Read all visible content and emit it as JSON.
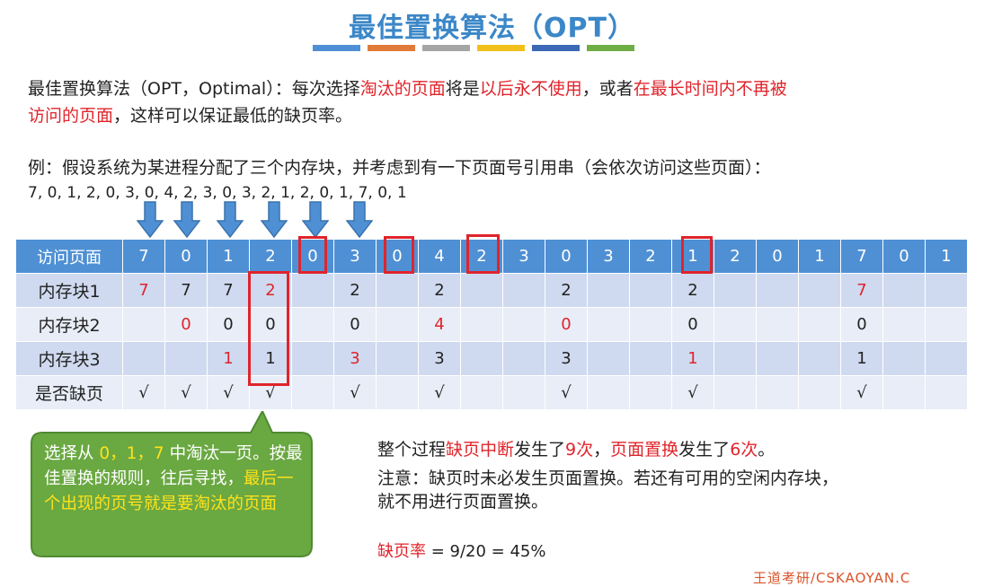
{
  "title": "最佳置换算法（OPT）",
  "title_bar_colors": [
    "#4f8fd6",
    "#e07b39",
    "#a5a5a5",
    "#f2c01b",
    "#3c68b5",
    "#6fae45"
  ],
  "intro": {
    "p1": "最佳置换算法（OPT，Optimal）：每次选择",
    "h1": "淘汰的页面",
    "p2": "将是",
    "h2": "以后永不使用",
    "p3": "，或者",
    "h3": "在最长时间内不再被",
    "h4": "访问的页面",
    "p4": "，这样可以保证最低的缺页率。"
  },
  "example": {
    "line1": "例：假设系统为某进程分配了三个内存块，并考虑到有一下页面号引用串（会依次访问这些页面）：",
    "line2": "7, 0, 1, 2, 0, 3, 0, 4, 2, 3, 0, 3, 2, 1, 2, 0, 1, 7, 0, 1"
  },
  "table": {
    "header_label": "访问页面",
    "pages": [
      "7",
      "0",
      "1",
      "2",
      "0",
      "3",
      "0",
      "4",
      "2",
      "3",
      "0",
      "3",
      "2",
      "1",
      "2",
      "0",
      "1",
      "7",
      "0",
      "1"
    ],
    "rows": [
      {
        "label": "内存块1",
        "cells": [
          "7",
          "7",
          "7",
          "2",
          "",
          "2",
          "",
          "2",
          "",
          "",
          "2",
          "",
          "",
          "2",
          "",
          "",
          "",
          "7",
          "",
          ""
        ],
        "red": [
          true,
          false,
          false,
          true,
          false,
          false,
          false,
          false,
          false,
          false,
          false,
          false,
          false,
          false,
          false,
          false,
          false,
          true,
          false,
          false
        ]
      },
      {
        "label": "内存块2",
        "cells": [
          "",
          "0",
          "0",
          "0",
          "",
          "0",
          "",
          "4",
          "",
          "",
          "0",
          "",
          "",
          "0",
          "",
          "",
          "",
          "0",
          "",
          ""
        ],
        "red": [
          false,
          true,
          false,
          false,
          false,
          false,
          false,
          true,
          false,
          false,
          true,
          false,
          false,
          false,
          false,
          false,
          false,
          false,
          false,
          false
        ]
      },
      {
        "label": "内存块3",
        "cells": [
          "",
          "",
          "1",
          "1",
          "",
          "3",
          "",
          "3",
          "",
          "",
          "3",
          "",
          "",
          "1",
          "",
          "",
          "",
          "1",
          "",
          ""
        ],
        "red": [
          false,
          false,
          true,
          false,
          false,
          true,
          false,
          false,
          false,
          false,
          false,
          false,
          false,
          true,
          false,
          false,
          false,
          false,
          false,
          false
        ]
      },
      {
        "label": "是否缺页",
        "cells": [
          "√",
          "√",
          "√",
          "√",
          "",
          "√",
          "",
          "√",
          "",
          "",
          "√",
          "",
          "",
          "√",
          "",
          "",
          "",
          "√",
          "",
          ""
        ],
        "red": [
          false,
          false,
          false,
          false,
          false,
          false,
          false,
          false,
          false,
          false,
          false,
          false,
          false,
          false,
          false,
          false,
          false,
          false,
          false,
          false
        ]
      }
    ]
  },
  "callout": {
    "p1": "选择从 ",
    "h1": "0，1，7",
    "p2": " 中淘汰一页。按最佳置换的规则，往后寻找，",
    "h2": "最后一个出现的页号就是要淘汰的页面"
  },
  "summary": {
    "p1": "整个过程",
    "h1": "缺页中断",
    "p2": "发生了",
    "h2": "9次",
    "p3": "，",
    "h3": "页面置换",
    "p4": "发生了",
    "h4": "6次",
    "p5": "。"
  },
  "note": {
    "line1": "注意：缺页时未必发生页面置换。若还有可用的空闲内存块，",
    "line2": "就不用进行页面置换。"
  },
  "fault_rate": {
    "label": "缺页率",
    "value": " = 9/20 = 45%"
  },
  "watermark": "王道考研/CSKAOYAN.C",
  "colors": {
    "accent": "#3b87c8",
    "highlight": "#e0242b",
    "header": "#4f90d4",
    "callout": "#6aa842",
    "callout_highlight": "#ffe21a"
  }
}
